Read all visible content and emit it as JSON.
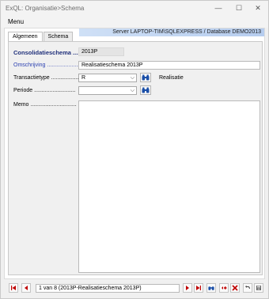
{
  "window": {
    "title": "ExQL: Organisatie>Schema",
    "minimize_glyph": "—",
    "maximize_glyph": "☐",
    "close_glyph": "✕"
  },
  "menubar": {
    "menu_label": "Menu"
  },
  "server_info": "Server LAPTOP-TIM\\SQLEXPRESS / Database DEMO2013",
  "tabs": [
    {
      "label": "Algemeen",
      "active": true
    },
    {
      "label": "Schema",
      "active": false
    }
  ],
  "form": {
    "header_label": "Consolidatieschema ....",
    "header_value": "2013P",
    "omschrijving_label": "Omschrijving .....................",
    "omschrijving_value": "Realisatieschema 2013P",
    "transactietype_label": "Transactietype ....................",
    "transactietype_value": "R",
    "transactietype_desc": "Realisatie",
    "periode_label": "Periode ...........................",
    "periode_value": "",
    "memo_label": "Memo ..............................",
    "memo_value": ""
  },
  "navigation": {
    "record_text": "1 van 8 (2013P-Realisatieschema 2013P)"
  },
  "colors": {
    "accent_header": "#1f2f7a",
    "link_label": "#2a3fb1",
    "nav_red": "#c00000",
    "binoc_blue": "#1b4fa8"
  }
}
